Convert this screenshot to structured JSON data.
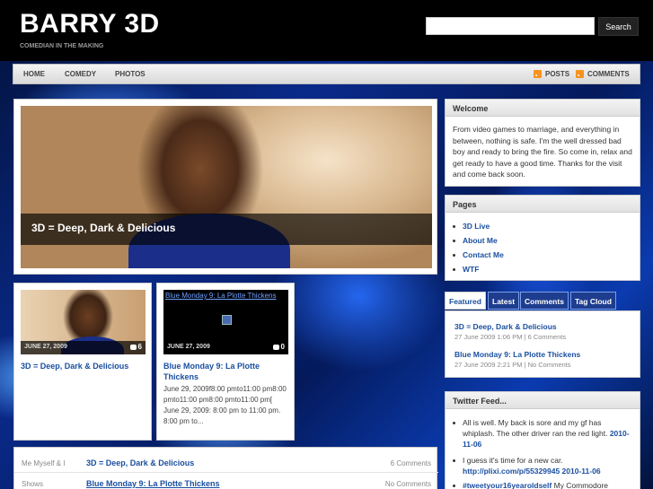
{
  "site": {
    "title": "BARRY 3D",
    "tagline": "COMEDIAN IN THE MAKING"
  },
  "search": {
    "placeholder": "",
    "button_label": "Search"
  },
  "nav": {
    "items": [
      {
        "label": "HOME"
      },
      {
        "label": "COMEDY"
      },
      {
        "label": "PHOTOS"
      }
    ],
    "feeds": {
      "posts": "POSTS",
      "comments": "COMMENTS"
    }
  },
  "featured": {
    "title": "3D = Deep, Dark & Delicious"
  },
  "cards": [
    {
      "date": "JUNE 27, 2009",
      "comments": "6",
      "title": "3D = Deep, Dark & Delicious",
      "excerpt": ""
    },
    {
      "date": "JUNE 27, 2009",
      "comments": "0",
      "thumb_title": "Blue Monday 9: La Plotte Thickens",
      "title": "Blue Monday 9: La Plotte Thickens",
      "excerpt": "June 29, 2009f8:00 pmto11:00 pm8:00 pmto11:00 pm8:00 pmto11:00 pm[ June 29, 2009: 8:00 pm to 11:00 pm. 8:00 pm to..."
    }
  ],
  "post_list": [
    {
      "category": "Me Myself & I",
      "title": "3D = Deep, Dark & Delicious",
      "comments": "6 Comments"
    },
    {
      "category": "Shows",
      "title": "Blue Monday 9: La Plotte Thickens",
      "comments": "No Comments"
    }
  ],
  "welcome": {
    "heading": "Welcome",
    "text": "From video games to marriage, and everything in between, nothing is safe. I'm the well dressed bad boy and ready to bring the fire. So come in, relax and get ready to have a good time. Thanks for the visit and come back soon."
  },
  "pages": {
    "heading": "Pages",
    "items": [
      {
        "label": "3D Live"
      },
      {
        "label": "About Me"
      },
      {
        "label": "Contact Me"
      },
      {
        "label": "WTF"
      }
    ]
  },
  "tabs": {
    "labels": [
      "Featured",
      "Latest",
      "Comments",
      "Tag Cloud"
    ],
    "active": "Featured",
    "items": [
      {
        "title": "3D = Deep, Dark & Delicious",
        "meta": "27 June 2009 1:06 PM | 6 Comments"
      },
      {
        "title": "Blue Monday 9: La Plotte Thickens",
        "meta": "27 June 2009 2:21 PM | No Comments"
      }
    ]
  },
  "twitter": {
    "heading": "Twitter Feed...",
    "tweets": [
      {
        "text": "All is well. My back is sore and my gf has whiplash. The other driver ran the red light.",
        "link": "2010-11-06"
      },
      {
        "text": "I guess it's time for a new car.",
        "link": "http://plixi.com/p/55329945 2010-11-06"
      },
      {
        "link": "#tweetyour16yearoldself",
        "text": " My Commodore"
      }
    ]
  },
  "colors": {
    "link": "#1a4fa0",
    "header_bg": "#000000",
    "tab_bg": "#1e3d8f",
    "rss": "#f7931e"
  }
}
